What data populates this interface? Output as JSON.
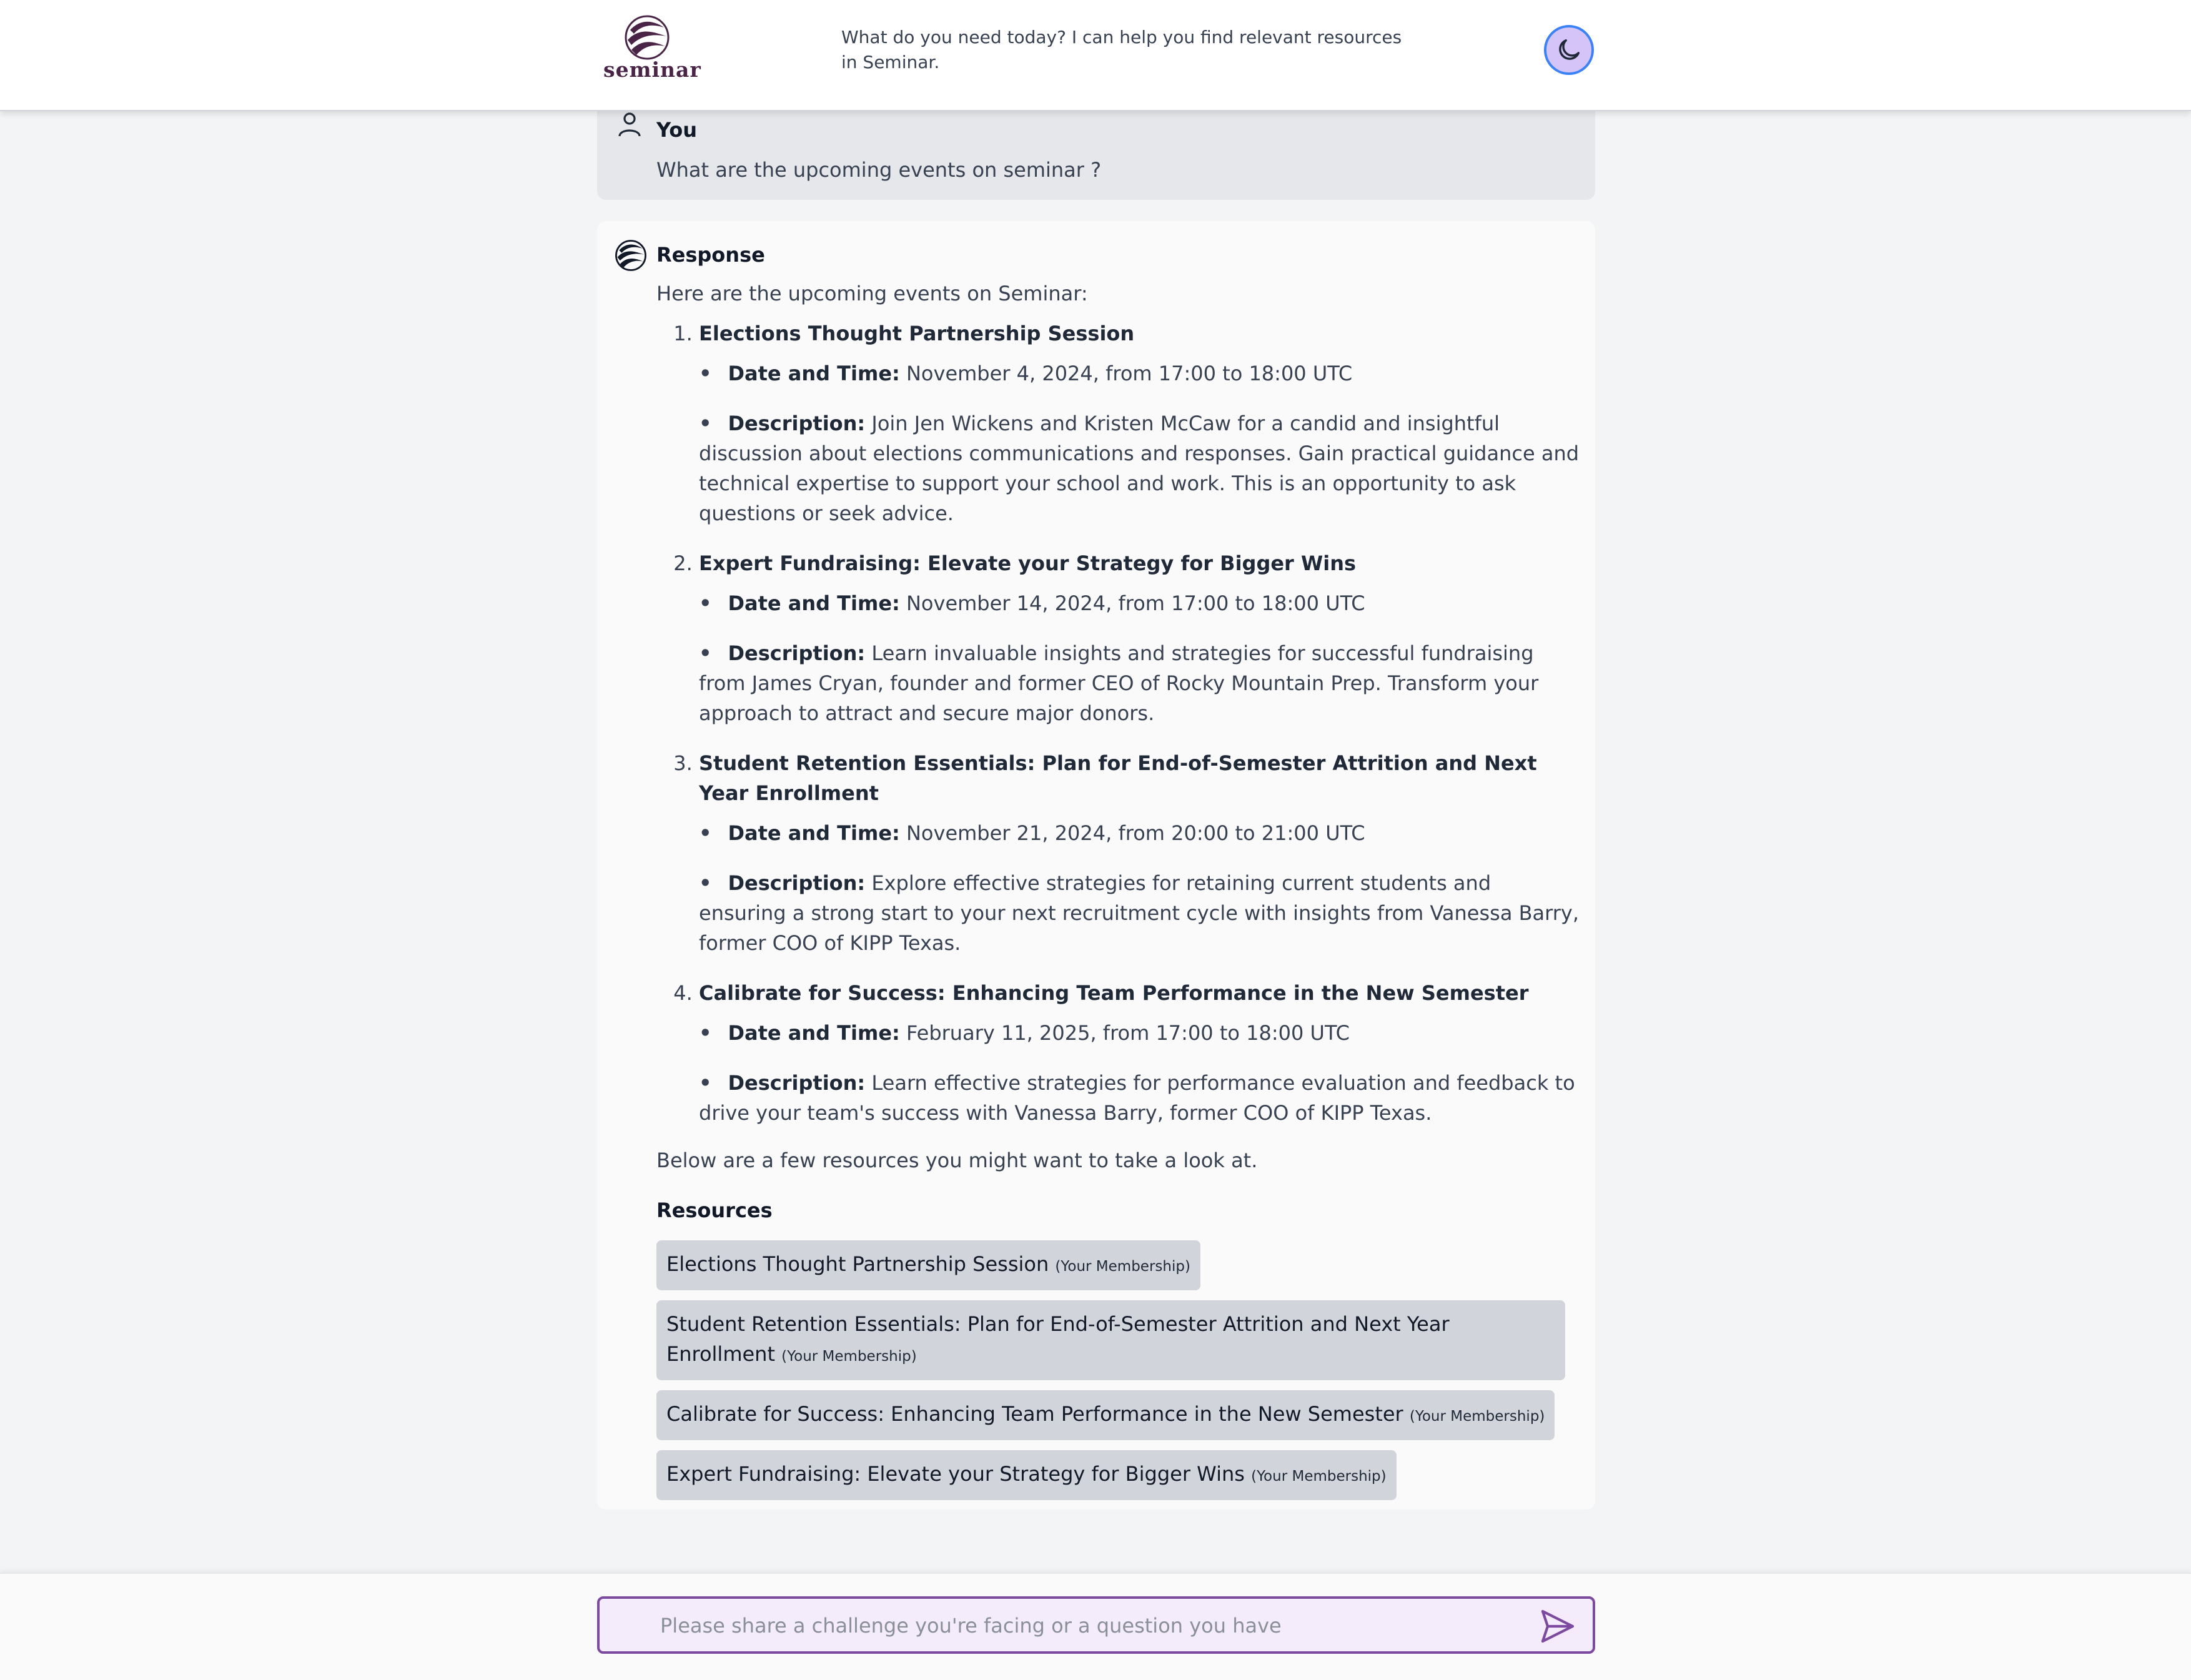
{
  "brand": {
    "name": "seminar"
  },
  "header": {
    "prompt": "What do you need today? I can help you find relevant resources in Seminar."
  },
  "user_message": {
    "author": "You",
    "text": "What are the upcoming events on seminar ?"
  },
  "response": {
    "author": "Response",
    "intro": "Here are the upcoming events on Seminar:",
    "events": [
      {
        "title": "Elections Thought Partnership Session",
        "date_label": "Date and Time:",
        "date": "November 4, 2024, from 17:00 to 18:00 UTC",
        "desc_label": "Description:",
        "desc": "Join Jen Wickens and Kristen McCaw for a candid and insightful discussion about elections communications and responses. Gain practical guidance and technical expertise to support your school and work. This is an opportunity to ask questions or seek advice."
      },
      {
        "title": "Expert Fundraising: Elevate your Strategy for Bigger Wins",
        "date_label": "Date and Time:",
        "date": "November 14, 2024, from 17:00 to 18:00 UTC",
        "desc_label": "Description:",
        "desc": "Learn invaluable insights and strategies for successful fundraising from James Cryan, founder and former CEO of Rocky Mountain Prep. Transform your approach to attract and secure major donors."
      },
      {
        "title": "Student Retention Essentials: Plan for End-of-Semester Attrition and Next Year Enrollment",
        "date_label": "Date and Time:",
        "date": "November 21, 2024, from 20:00 to 21:00 UTC",
        "desc_label": "Description:",
        "desc": "Explore effective strategies for retaining current students and ensuring a strong start to your next recruitment cycle with insights from Vanessa Barry, former COO of KIPP Texas."
      },
      {
        "title": "Calibrate for Success: Enhancing Team Performance in the New Semester",
        "date_label": "Date and Time:",
        "date": "February 11, 2025, from 17:00 to 18:00 UTC",
        "desc_label": "Description:",
        "desc": "Learn effective strategies for performance evaluation and feedback to drive your team's success with Vanessa Barry, former COO of KIPP Texas."
      }
    ],
    "outro": "Below are a few resources you might want to take a look at.",
    "resources_label": "Resources",
    "resources": [
      {
        "title": "Elections Thought Partnership Session",
        "tag": "(Your Membership)"
      },
      {
        "title": "Student Retention Essentials: Plan for End-of-Semester Attrition and Next Year Enrollment",
        "tag": "(Your Membership)"
      },
      {
        "title": "Calibrate for Success: Enhancing Team Performance in the New Semester",
        "tag": "(Your Membership)"
      },
      {
        "title": "Expert Fundraising: Elevate your Strategy for Bigger Wins",
        "tag": "(Your Membership)"
      }
    ]
  },
  "composer": {
    "placeholder": "Please share a challenge you're facing or a question you have"
  },
  "icons": {
    "theme": "moon-icon",
    "send": "send-icon",
    "user": "user-icon",
    "assistant": "seminar-logo-icon"
  },
  "colors": {
    "brand": "#4a2447",
    "accent_border": "#7c4a9e",
    "toggle_bg": "#d5c4f7",
    "toggle_border": "#3b82f6"
  }
}
